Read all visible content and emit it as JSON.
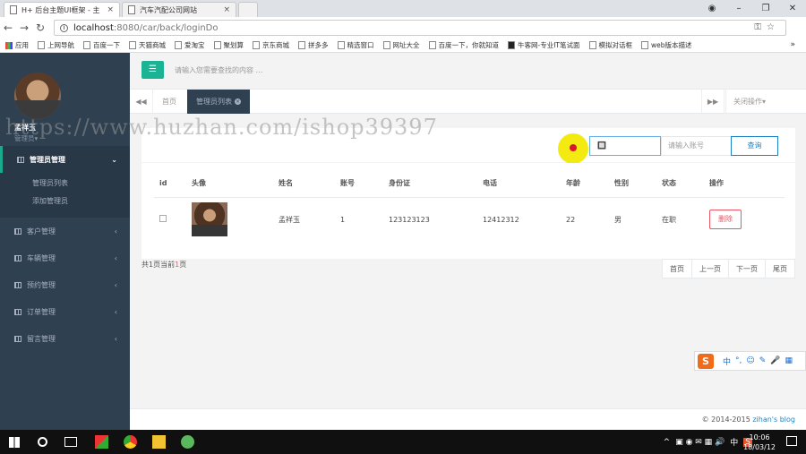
{
  "browser": {
    "tabs": [
      {
        "title": "H+ 后台主题UI框架 - 主",
        "close": "×"
      },
      {
        "title": "汽车汽配公司网站",
        "close": "×"
      }
    ],
    "url_host": "localhost",
    "url_rest": ":8080/car/back/loginDo",
    "bookmarks": [
      "应用",
      "上网导航",
      "百度一下",
      "天猫商城",
      "爱淘宝",
      "聚划算",
      "京东商城",
      "拼多多",
      "精选窗口",
      "网址大全",
      "百度一下，你就知道",
      "牛客网-专业IT笔试面",
      "模拟对话框",
      "web版本描述"
    ],
    "bookmarks_more": "»"
  },
  "sidebar": {
    "user_name": "孟祥玉",
    "user_role": "管理员▾",
    "active_section": "管理员管理",
    "sub_items": [
      "管理员列表",
      "添加管理员"
    ],
    "sections": [
      "客户管理",
      "车辆管理",
      "预约管理",
      "订单管理",
      "留言管理"
    ]
  },
  "header": {
    "search_placeholder": "请输入您需要查找的内容 …"
  },
  "content_tabs": {
    "home": "首页",
    "active": "管理员列表",
    "close_ops": "关闭操作▾"
  },
  "search": {
    "select_value": "🔲",
    "account_placeholder": "请输入账号",
    "query_button": "查询"
  },
  "table": {
    "headers": [
      "id",
      "头像",
      "姓名",
      "账号",
      "身份证",
      "电话",
      "年龄",
      "性别",
      "状态",
      "操作"
    ],
    "rows": [
      {
        "name": "孟祥玉",
        "account": "1",
        "id_card": "123123123",
        "phone": "12412312",
        "age": "22",
        "gender": "男",
        "status": "在职",
        "action": "删除"
      }
    ]
  },
  "pagination": {
    "info_prefix": "共",
    "total": "1",
    "info_mid": "页当前",
    "current": "1",
    "info_suffix": "页",
    "buttons": [
      "首页",
      "上一页",
      "下一页",
      "尾页"
    ]
  },
  "watermark": "https://www.huzhan.com/ishop39397",
  "ime": {
    "logo": "S",
    "items": [
      "中",
      "°,",
      "☺",
      "✎",
      "🎤",
      "▦"
    ]
  },
  "footer": {
    "copyright": "© 2014-2015 ",
    "brand": "zihan's blog"
  },
  "taskbar": {
    "time": "10:06",
    "date": "18/03/12",
    "tray": [
      "^",
      "中",
      "S"
    ]
  }
}
